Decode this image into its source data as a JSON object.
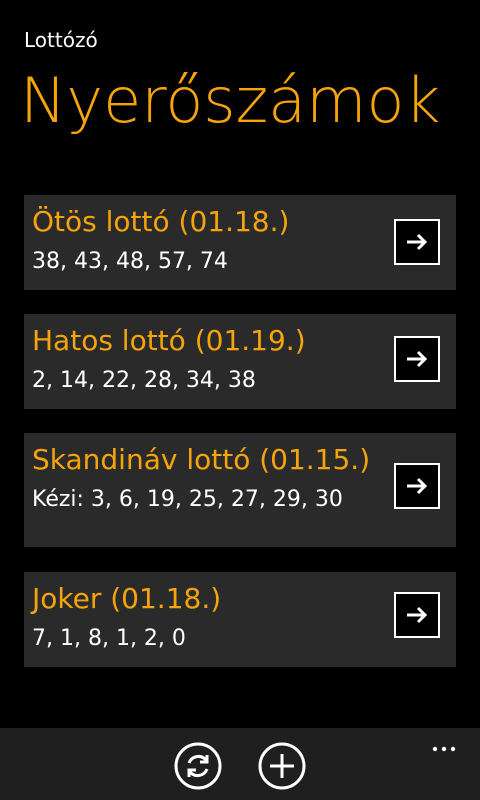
{
  "header": {
    "app_title": "Lottózó",
    "page_title": "Nyerőszámok"
  },
  "cards": [
    {
      "title": "Ötös lottó (01.18.)",
      "numbers": "38, 43, 48, 57, 74"
    },
    {
      "title": "Hatos lottó (01.19.)",
      "numbers": "2, 14, 22, 28, 34, 38"
    },
    {
      "title": "Skandináv lottó (01.15.)",
      "numbers": "Kézi: 3, 6, 19, 25, 27, 29, 30"
    },
    {
      "title": "Joker (01.18.)",
      "numbers": "7, 1, 8, 1, 2, 0"
    }
  ],
  "appbar": {
    "buttons": [
      "refresh-icon",
      "add-icon"
    ],
    "more": "more-icon"
  },
  "colors": {
    "accent": "#f5a40b",
    "card_bg": "#2a2a2a",
    "background": "#000000",
    "appbar_bg": "#1f1f1f"
  }
}
